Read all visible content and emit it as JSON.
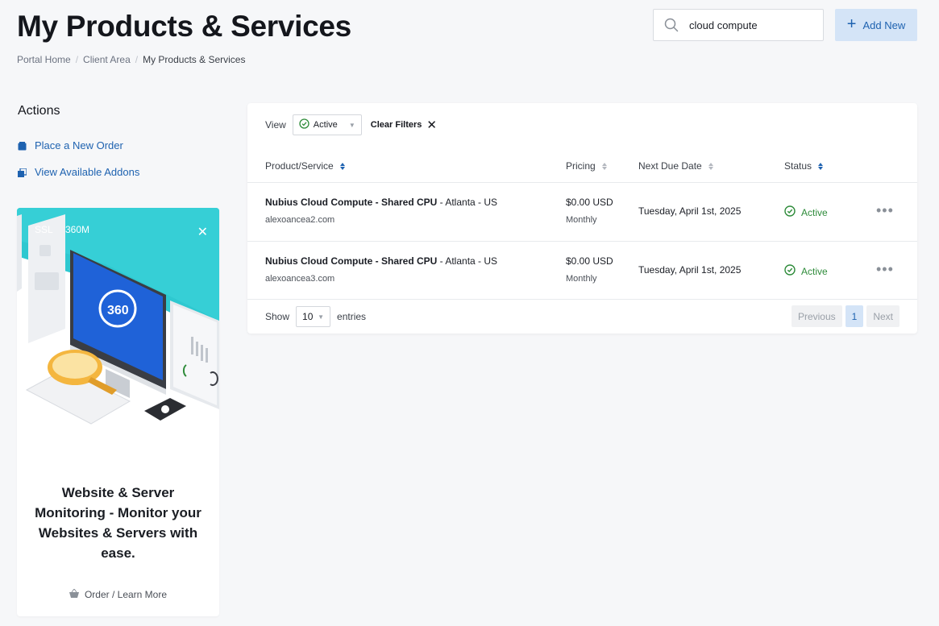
{
  "header": {
    "title": "My Products & Services",
    "breadcrumb": [
      "Portal Home",
      "Client Area",
      "My Products & Services"
    ],
    "search_value": "cloud compute",
    "add_new_label": "Add New"
  },
  "sidebar": {
    "actions_title": "Actions",
    "actions": [
      {
        "label": "Place a New Order",
        "icon": "cart-icon"
      },
      {
        "label": "View Available Addons",
        "icon": "addons-icon"
      }
    ],
    "promo": {
      "art_labels": [
        "SSL",
        "360M"
      ],
      "heading": "Website & Server Monitoring - Monitor your Websites & Servers with ease.",
      "link_label": "Order / Learn More",
      "accent_color": "#2ec8d0"
    }
  },
  "table": {
    "view_label": "View",
    "view_value": "Active",
    "clear_filters_label": "Clear Filters",
    "columns": [
      "Product/Service",
      "Pricing",
      "Next Due Date",
      "Status"
    ],
    "rows": [
      {
        "product": "Nubius Cloud Compute - Shared CPU",
        "location": " - Atlanta - US",
        "domain": "alexoancea2.com",
        "price": "$0.00 USD",
        "cycle": "Monthly",
        "due": "Tuesday, April 1st, 2025",
        "status": "Active"
      },
      {
        "product": "Nubius Cloud Compute - Shared CPU",
        "location": " - Atlanta - US",
        "domain": "alexoancea3.com",
        "price": "$0.00 USD",
        "cycle": "Monthly",
        "due": "Tuesday, April 1st, 2025",
        "status": "Active"
      }
    ],
    "show_label": "Show",
    "page_length": "10",
    "entries_label": "entries",
    "pager": {
      "previous": "Previous",
      "current": "1",
      "next": "Next"
    }
  },
  "colors": {
    "accent": "#1e62b0",
    "active_status": "#2e8b3a",
    "background": "#f6f7f9"
  }
}
